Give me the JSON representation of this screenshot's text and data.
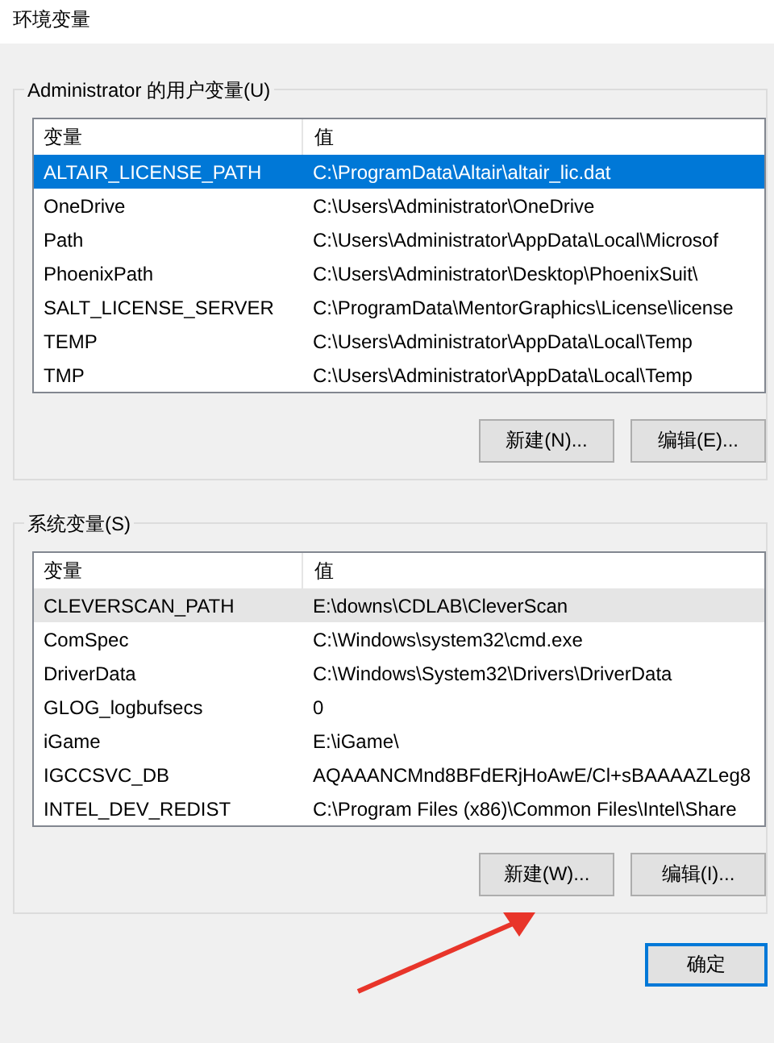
{
  "window": {
    "title": "环境变量"
  },
  "user_variables": {
    "label": "Administrator 的用户变量(U)",
    "columns": [
      "变量",
      "值"
    ],
    "rows": [
      {
        "name": "ALTAIR_LICENSE_PATH",
        "value": "C:\\ProgramData\\Altair\\altair_lic.dat",
        "selected": true,
        "highlighted": false
      },
      {
        "name": "OneDrive",
        "value": "C:\\Users\\Administrator\\OneDrive",
        "selected": false,
        "highlighted": false
      },
      {
        "name": "Path",
        "value": "C:\\Users\\Administrator\\AppData\\Local\\Microsof",
        "selected": false,
        "highlighted": false
      },
      {
        "name": "PhoenixPath",
        "value": "C:\\Users\\Administrator\\Desktop\\PhoenixSuit\\",
        "selected": false,
        "highlighted": false
      },
      {
        "name": "SALT_LICENSE_SERVER",
        "value": "C:\\ProgramData\\MentorGraphics\\License\\license",
        "selected": false,
        "highlighted": false
      },
      {
        "name": "TEMP",
        "value": "C:\\Users\\Administrator\\AppData\\Local\\Temp",
        "selected": false,
        "highlighted": false
      },
      {
        "name": "TMP",
        "value": "C:\\Users\\Administrator\\AppData\\Local\\Temp",
        "selected": false,
        "highlighted": false
      }
    ],
    "buttons": [
      "新建(N)...",
      "编辑(E)..."
    ]
  },
  "system_variables": {
    "label": "系统变量(S)",
    "columns": [
      "变量",
      "值"
    ],
    "rows": [
      {
        "name": "CLEVERSCAN_PATH",
        "value": "E:\\downs\\CDLAB\\CleverScan",
        "selected": false,
        "highlighted": true
      },
      {
        "name": "ComSpec",
        "value": "C:\\Windows\\system32\\cmd.exe",
        "selected": false,
        "highlighted": false
      },
      {
        "name": "DriverData",
        "value": "C:\\Windows\\System32\\Drivers\\DriverData",
        "selected": false,
        "highlighted": false
      },
      {
        "name": "GLOG_logbufsecs",
        "value": "0",
        "selected": false,
        "highlighted": false
      },
      {
        "name": "iGame",
        "value": "E:\\iGame\\",
        "selected": false,
        "highlighted": false
      },
      {
        "name": "IGCCSVC_DB",
        "value": "AQAAANCMnd8BFdERjHoAwE/Cl+sBAAAAZLeg8",
        "selected": false,
        "highlighted": false
      },
      {
        "name": "INTEL_DEV_REDIST",
        "value": "C:\\Program Files (x86)\\Common Files\\Intel\\Share",
        "selected": false,
        "highlighted": false
      }
    ],
    "buttons": [
      "新建(W)...",
      "编辑(I)..."
    ]
  },
  "dialog_buttons": [
    {
      "label": "确定",
      "default": true
    }
  ]
}
